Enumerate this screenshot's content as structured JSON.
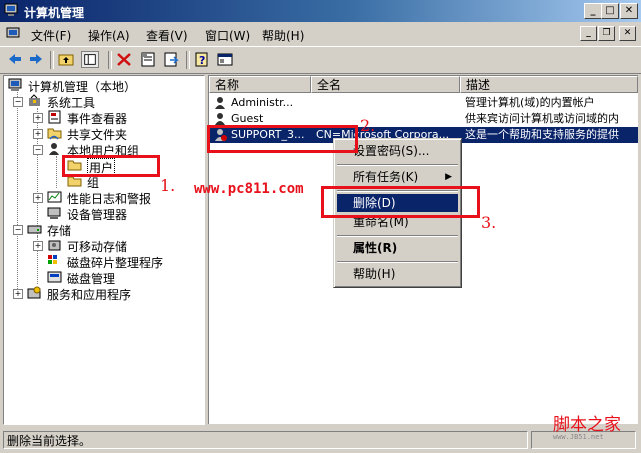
{
  "window": {
    "title": "计算机管理"
  },
  "menubar": {
    "items": [
      "文件(F)",
      "操作(A)",
      "查看(V)",
      "窗口(W)",
      "帮助(H)"
    ]
  },
  "tree": {
    "root": "计算机管理（本地）",
    "system_tools": "系统工具",
    "event_viewer": "事件查看器",
    "shared_folders": "共享文件夹",
    "local_users_groups": "本地用户和组",
    "users": "用户",
    "groups": "组",
    "perf_logs": "性能日志和警报",
    "device_manager": "设备管理器",
    "storage": "存储",
    "removable_storage": "可移动存储",
    "defrag": "磁盘碎片整理程序",
    "disk_mgmt": "磁盘管理",
    "services_apps": "服务和应用程序"
  },
  "list": {
    "columns": [
      "名称",
      "全名",
      "描述"
    ],
    "rows": [
      {
        "name": "Administr...",
        "fullname": "",
        "desc": "管理计算机(域)的内置帐户"
      },
      {
        "name": "Guest",
        "fullname": "",
        "desc": "供来宾访问计算机或访问域的内"
      },
      {
        "name": "SUPPORT_3...",
        "fullname": "CN=Microsoft Corpora...",
        "desc": "这是一个帮助和支持服务的提供"
      }
    ]
  },
  "context_menu": {
    "set_password": "设置密码(S)...",
    "all_tasks": "所有任务(K)",
    "delete": "删除(D)",
    "rename": "重命名(M)",
    "properties": "属性(R)",
    "help": "帮助(H)"
  },
  "status": {
    "text": "删除当前选择。"
  },
  "annotations": {
    "step1": "1.",
    "step2": "2.",
    "step3": "3.",
    "watermark": "www.pc811.com",
    "brand": "脚本之家",
    "brand_url": "www.JB51.net"
  },
  "colors": {
    "annotation_red": "#e8101a",
    "selection_blue": "#0a246a"
  }
}
